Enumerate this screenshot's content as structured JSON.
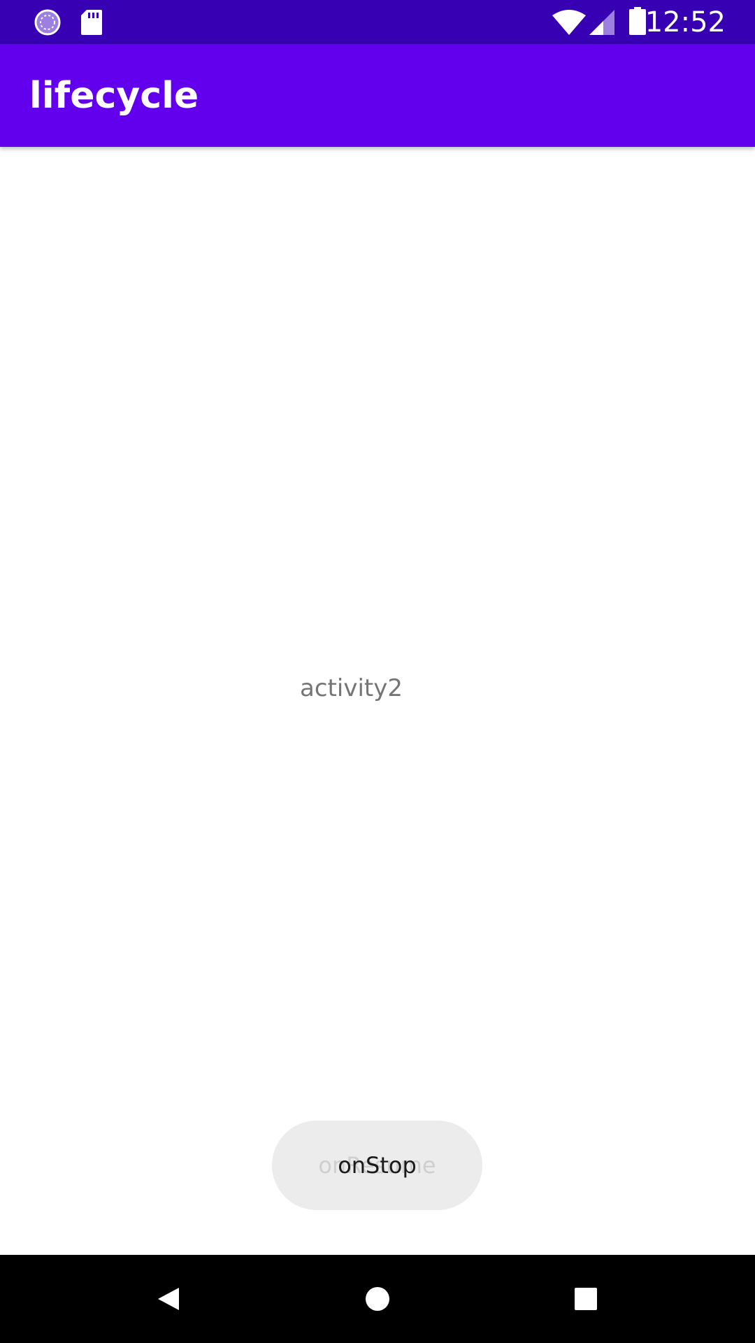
{
  "status_bar": {
    "time": "12:52",
    "background": "#3700B3",
    "left_icons": [
      "loading-icon",
      "sd-card-icon"
    ],
    "right_icons": [
      "wifi-icon",
      "signal-icon",
      "battery-icon"
    ]
  },
  "app_bar": {
    "title": "lifecycle",
    "background": "#6200EE"
  },
  "content": {
    "label": "activity2"
  },
  "toast": {
    "text": "onStop",
    "ghost_text": "onResume",
    "background": "#ececec"
  },
  "nav_bar": {
    "background": "#000000",
    "buttons": [
      "back-icon",
      "home-icon",
      "recents-icon"
    ]
  }
}
